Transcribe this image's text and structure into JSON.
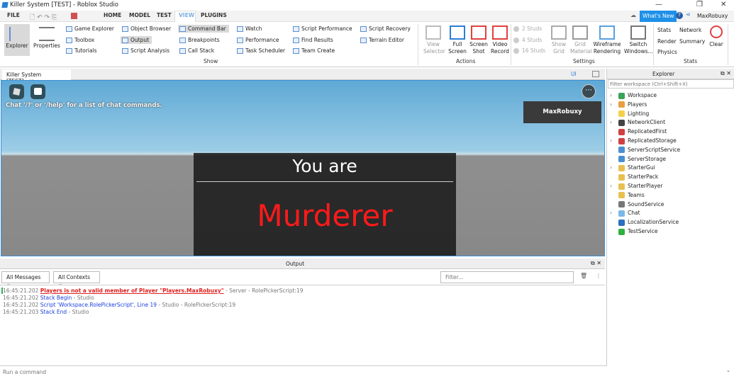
{
  "window": {
    "title": "Killer System [TEST] - Roblox Studio",
    "min": "—",
    "max": "❐",
    "close": "✕"
  },
  "menu": {
    "tabs": [
      "FILE",
      "HOME",
      "MODEL",
      "TEST",
      "VIEW",
      "PLUGINS"
    ],
    "active": "VIEW",
    "whats_new": "What's New",
    "user": "MaxRobuxy"
  },
  "ribbon": {
    "explorer": "Explorer",
    "properties": "Properties",
    "col1": [
      "Game Explorer",
      "Toolbox",
      "Tutorials"
    ],
    "col2": [
      "Object Browser",
      "Output",
      "Script Analysis"
    ],
    "col3": [
      "Command Bar",
      "Breakpoints",
      "Call Stack"
    ],
    "col4": [
      "Watch",
      "Performance",
      "Task Scheduler"
    ],
    "col5": [
      "Script Performance",
      "Find Results",
      "Team Create"
    ],
    "col6": [
      "Script Recovery",
      "Terrain Editor"
    ],
    "show_label": "Show",
    "actions": [
      "View Selector",
      "Full Screen",
      "Screen Shot",
      "Video Record"
    ],
    "actions_label": "Actions",
    "studs": [
      "2 Studs",
      "4 Studs",
      "16 Studs"
    ],
    "settings": [
      "Show Grid",
      "Grid Material",
      "Wireframe Rendering",
      "Switch Windows..."
    ],
    "settings_label": "Settings",
    "stats": [
      "Stats",
      "Network",
      "Render",
      "Summary",
      "Physics"
    ],
    "clear": "Clear",
    "stats_label": "Stats"
  },
  "viewport": {
    "tab": "Killer System [TEST]",
    "ui_label": "UI",
    "chat_hint": "Chat '/?' or '/help' for a list of chat commands.",
    "player": "MaxRobuxy",
    "you_are": "You are",
    "role": "Murderer",
    "role_color": "#ff1a1a"
  },
  "output": {
    "title": "Output",
    "filter1": "All Messages",
    "filter2": "All Contexts",
    "filter_placeholder": "Filter...",
    "lines": [
      {
        "time": "16:45:21.202",
        "msg": "Players is not a valid member of Player \"Players.MaxRobuxy\"",
        "ctx": " - Server - RolePickerScript:19"
      },
      {
        "time": "16:45:21.202",
        "msg": "Stack Begin",
        "ctx": " - Studio"
      },
      {
        "time": "16:45:21.202",
        "msg": "Script 'Workspace.RolePickerScript', Line 19",
        "ctx": " - Studio - RolePickerScript:19"
      },
      {
        "time": "16:45:21.203",
        "msg": "Stack End",
        "ctx": " - Studio"
      }
    ]
  },
  "command_bar": {
    "placeholder": "Run a command"
  },
  "explorer": {
    "title": "Explorer",
    "filter_placeholder": "Filter workspace (Ctrl+Shift+X)",
    "items": [
      {
        "name": "Workspace",
        "exp": true,
        "color": "#3aa35a"
      },
      {
        "name": "Players",
        "exp": true,
        "color": "#e8a040"
      },
      {
        "name": "Lighting",
        "exp": false,
        "color": "#f5d04a"
      },
      {
        "name": "NetworkClient",
        "exp": true,
        "color": "#444"
      },
      {
        "name": "ReplicatedFirst",
        "exp": false,
        "color": "#d04040"
      },
      {
        "name": "ReplicatedStorage",
        "exp": true,
        "color": "#d04040"
      },
      {
        "name": "ServerScriptService",
        "exp": false,
        "color": "#4a90d0"
      },
      {
        "name": "ServerStorage",
        "exp": false,
        "color": "#4a90d0"
      },
      {
        "name": "StarterGui",
        "exp": true,
        "color": "#e8c050"
      },
      {
        "name": "StarterPack",
        "exp": false,
        "color": "#e8c050"
      },
      {
        "name": "StarterPlayer",
        "exp": true,
        "color": "#e8c050"
      },
      {
        "name": "Teams",
        "exp": false,
        "color": "#e8c050"
      },
      {
        "name": "SoundService",
        "exp": false,
        "color": "#777"
      },
      {
        "name": "Chat",
        "exp": true,
        "color": "#7ab8e8"
      },
      {
        "name": "LocalizationService",
        "exp": false,
        "color": "#2a6fc0"
      },
      {
        "name": "TestService",
        "exp": false,
        "color": "#2fb040"
      }
    ]
  }
}
